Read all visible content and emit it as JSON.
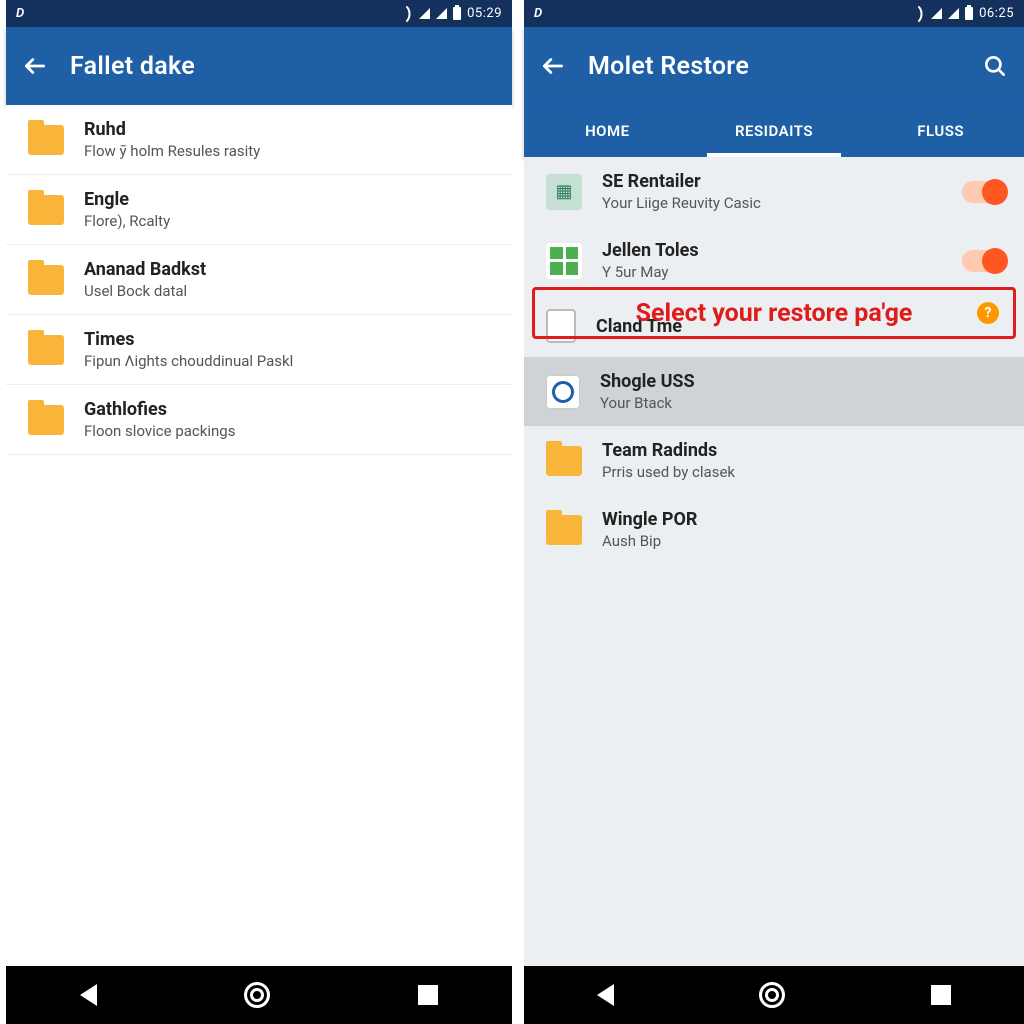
{
  "left": {
    "status_time": "05:29",
    "title": "Fallet dake",
    "items": [
      {
        "title": "Ruhd",
        "sub": "Flow ỹ holm Resules rasity"
      },
      {
        "title": "Engle",
        "sub": "Flore), Rcalty"
      },
      {
        "title": "Ananad Badkst",
        "sub": "Usel Bock datal"
      },
      {
        "title": "Times",
        "sub": "Fipun Λights chouddinual Paskl"
      },
      {
        "title": "Gathlofies",
        "sub": "Floon slovice packings"
      }
    ]
  },
  "right": {
    "status_time": "06:25",
    "title": "Molet Restore",
    "tabs": [
      "HOME",
      "RESIDAITS",
      "FLUSS"
    ],
    "active_tab": 1,
    "callout": "Select your restore pa'ge",
    "items": [
      {
        "icon": "teal",
        "title": "SE Rentailer",
        "sub": "Your Liige Reuvity Casic",
        "toggle": true
      },
      {
        "icon": "green",
        "title": "Jellen Toles",
        "sub": "Y 5ur May",
        "toggle": true
      },
      {
        "icon": "doc",
        "title": "Cland Tme",
        "sub": ""
      },
      {
        "icon": "globe",
        "title": "Shogle USS",
        "sub": "Your Btack",
        "selected": true
      },
      {
        "icon": "folder",
        "title": "Team Radinds",
        "sub": "Prris used by clasek"
      },
      {
        "icon": "folder",
        "title": "Wingle POR",
        "sub": "Aush Bip"
      }
    ]
  }
}
